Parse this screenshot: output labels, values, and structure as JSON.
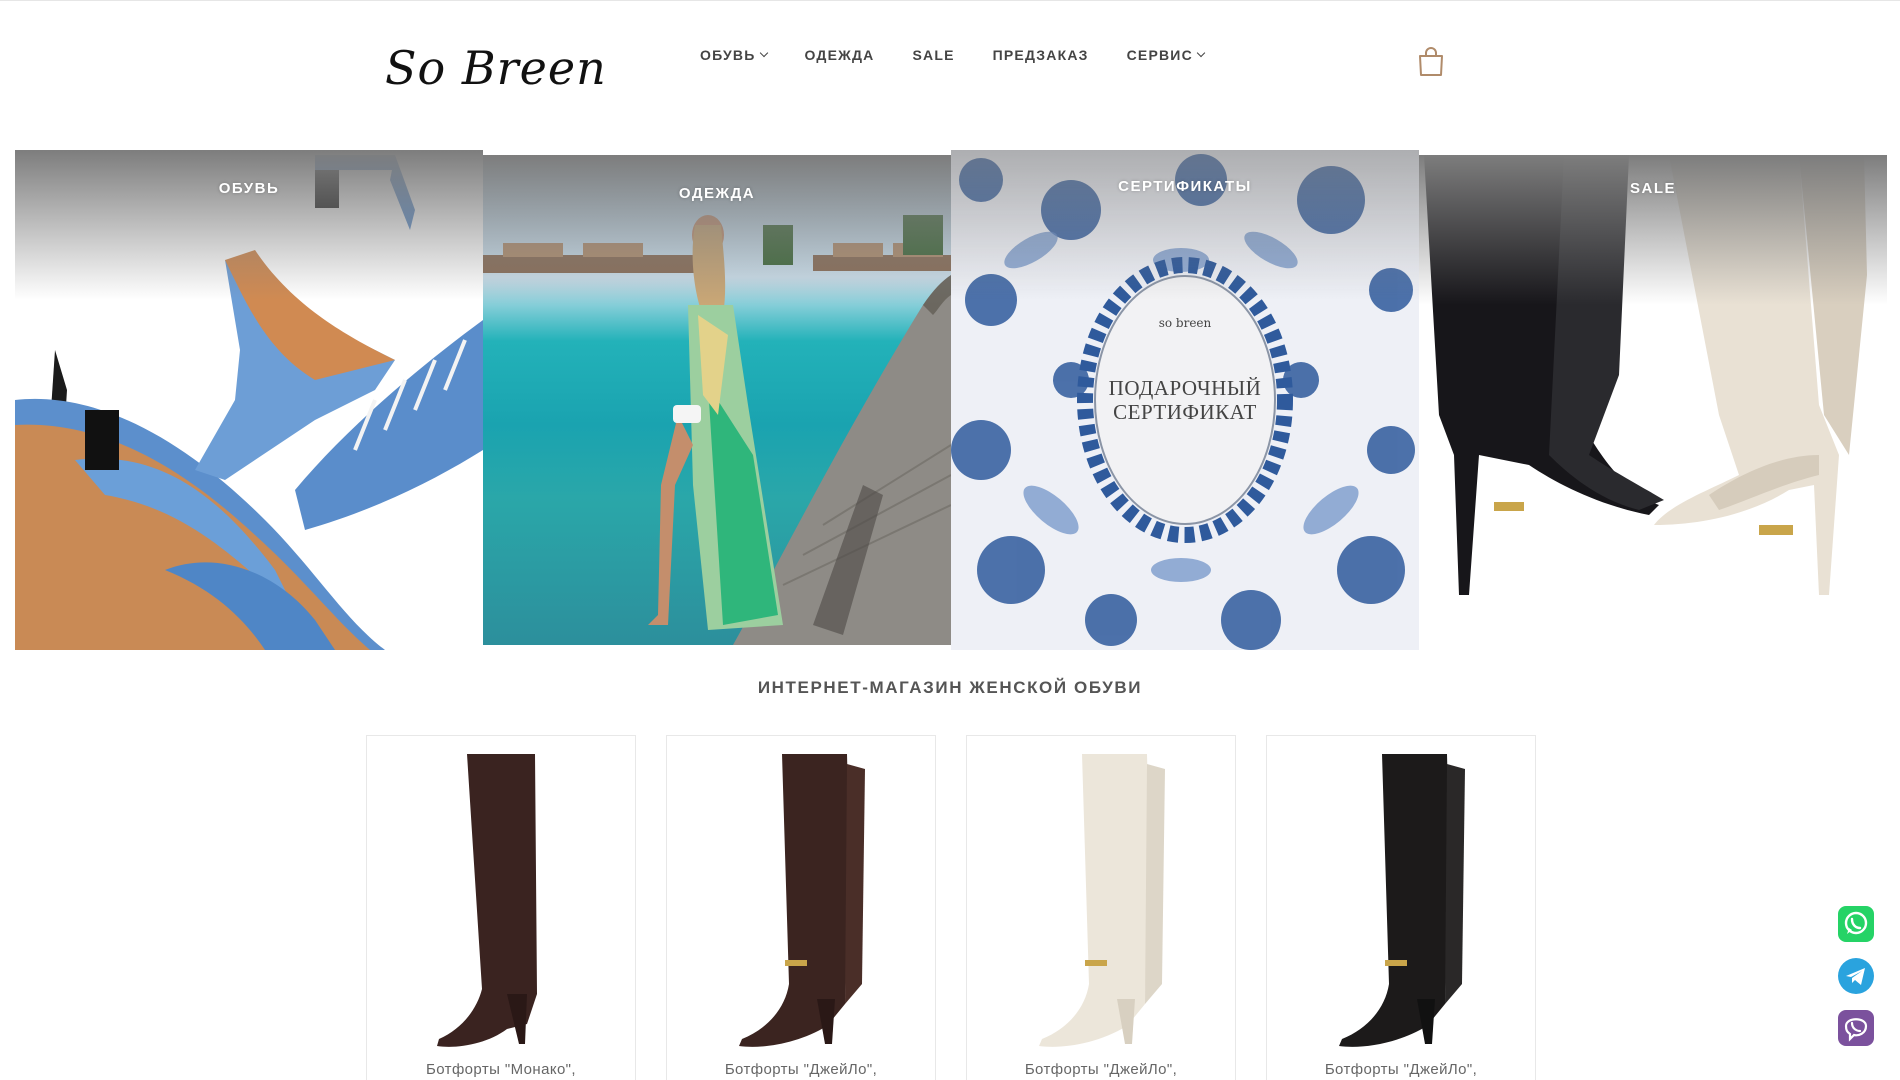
{
  "header": {
    "logo_text": "So Breen",
    "nav": [
      {
        "label": "ОБУВЬ",
        "dropdown": true
      },
      {
        "label": "ОДЕЖДА",
        "dropdown": false
      },
      {
        "label": "SALE",
        "dropdown": false
      },
      {
        "label": "ПРЕДЗАКАЗ",
        "dropdown": false
      },
      {
        "label": "СЕРВИС",
        "dropdown": true
      }
    ],
    "cart_icon": "shopping-bag-icon"
  },
  "categories": [
    {
      "title": "ОБУВЬ"
    },
    {
      "title": "ОДЕЖДА"
    },
    {
      "title": "СЕРТИФИКАТЫ",
      "certificate_brand": "so breen",
      "certificate_line1": "ПОДАРОЧНЫЙ",
      "certificate_line2": "СЕРТИФИКАТ"
    },
    {
      "title": "SALE"
    }
  ],
  "headline": "ИНТЕРНЕТ-МАГАЗИН ЖЕНСКОЙ ОБУВИ",
  "products": [
    {
      "name": "Ботфорты \"Монако\",",
      "color": "#3a2320"
    },
    {
      "name": "Ботфорты \"ДжейЛо\",",
      "color": "#3b2420"
    },
    {
      "name": "Ботфорты \"ДжейЛо\",",
      "color": "#ece6da"
    },
    {
      "name": "Ботфорты \"ДжейЛо\",",
      "color": "#1c1a1a"
    }
  ],
  "messengers": [
    "whatsapp-icon",
    "telegram-icon",
    "viber-icon"
  ],
  "colors": {
    "accent_cart": "#b08b6a",
    "whatsapp": "#25d366",
    "telegram": "#2aa3de",
    "viber": "#7b519d"
  }
}
